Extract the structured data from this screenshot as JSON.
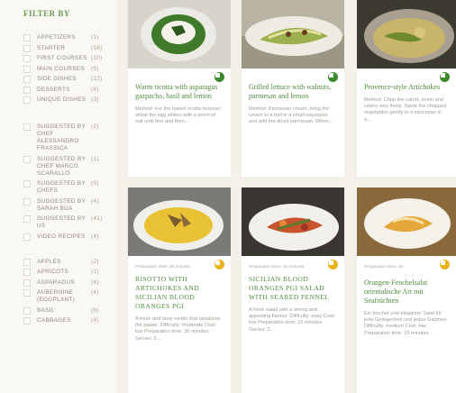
{
  "filter": {
    "title": "FILTER BY",
    "courses": [
      {
        "label": "APPETIZERS",
        "count": "(1)"
      },
      {
        "label": "STARTER",
        "count": "(16)"
      },
      {
        "label": "FIRST COURSES",
        "count": "(10)"
      },
      {
        "label": "MAIN COURSES",
        "count": "(9)"
      },
      {
        "label": "SIDE DISHES",
        "count": "(12)"
      },
      {
        "label": "DESSERTS",
        "count": "(4)"
      },
      {
        "label": "UNIQUE DISHES",
        "count": "(3)"
      }
    ],
    "suggested": [
      {
        "label": "SUGGESTED BY CHEF ALESSANDRO FRASSICA",
        "count": "(2)"
      },
      {
        "label": "SUGGESTED BY CHEF MARCO SCARALLO",
        "count": "(1)"
      },
      {
        "label": "SUGGESTED BY CHEFS",
        "count": "(9)"
      },
      {
        "label": "SUGGESTED BY SARAH BUA",
        "count": "(4)"
      },
      {
        "label": "SUGGESTED BY US",
        "count": "(41)"
      },
      {
        "label": "VIDEO RECIPES",
        "count": "(4)"
      }
    ],
    "ingredients": [
      {
        "label": "APPLES",
        "count": "(2)"
      },
      {
        "label": "APRICOTS",
        "count": "(1)"
      },
      {
        "label": "ASPARAGUS",
        "count": "(4)"
      },
      {
        "label": "AUBERGINE (EGGPLANT)",
        "count": "(4)"
      },
      {
        "label": "BASIL",
        "count": "(6)"
      },
      {
        "label": "CABBAGES",
        "count": "(4)"
      }
    ]
  },
  "cards": [
    {
      "title": "Warm ricotta with asparagus gazpacho, basil and lemon",
      "desc": "Method: For the baked ricotta mousse: whisk the egg whites with a pinch of salt until firm and then…",
      "difficulty": "green",
      "prep": ""
    },
    {
      "title": "Grilled lettuce with walnuts, parmesan and lemon",
      "desc": "Method: Parmesan cream: bring the cream to a boil in a small saucepan and add the diced parmesan. When…",
      "difficulty": "green",
      "prep": ""
    },
    {
      "title": "Provence-style Artichokes",
      "desc": "Method: Chop the carrot, onion and celery very finely. Sauté the chopped vegetables gently in a saucepan in a…",
      "difficulty": "green",
      "prep": ""
    },
    {
      "title": "RISOTTO WITH ARTICHOKES AND SICILIAN BLOOD ORANGES PGI",
      "desc": "A fresh and tasty risotto that tantalizes the palate. Difficulty: moderate Cost: low Preparation time: 30 minutes Serves: 2…",
      "difficulty": "yellow",
      "prep": "Preparation time: 30 minutes"
    },
    {
      "title": "SICILIAN BLOOD ORANGES PGI SALAD WITH SEARED FENNEL",
      "desc": "A fresh salad with a strong and appealing flavour. Difficulty: easy Cost: low Preparation time: 15 minutes Serves: 2…",
      "difficulty": "yellow",
      "prep": "Preparation time: 15 minutes"
    },
    {
      "title": "Orangen-Fenchelsalat orientalische Art mit Seafrüchten",
      "desc": "Ein frischer und eleganter Salat für jede Gelegenheit und jeden Gaumen. Difficulty: medium Cost: low Preparation time: 15 minutes…",
      "difficulty": "yellow",
      "prep": "Preparation time: 15"
    }
  ]
}
